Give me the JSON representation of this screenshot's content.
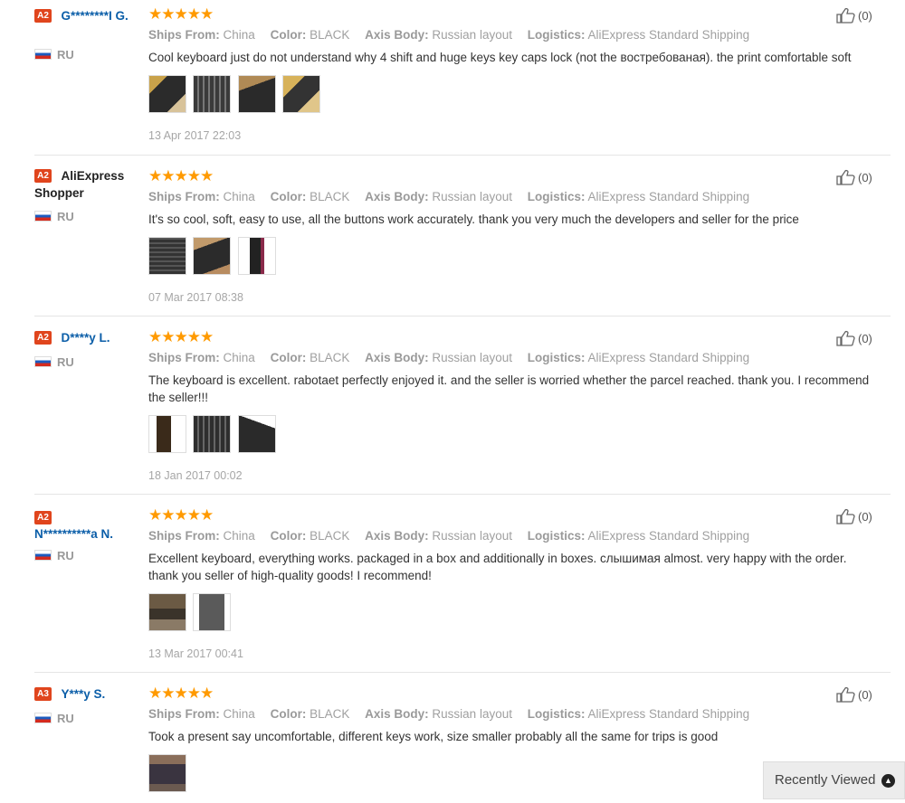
{
  "labels": {
    "ships_from": "Ships From:",
    "color": "Color:",
    "axis_body": "Axis Body:",
    "logistics": "Logistics:"
  },
  "reviews": [
    {
      "badge": "A2",
      "name": "G********I G.",
      "country": "RU",
      "stars": "★★★★★",
      "ships_from": "China",
      "color": "BLACK",
      "axis_body": "Russian layout",
      "logistics": "AliExpress Standard Shipping",
      "text": "Cool keyboard just do not understand why 4 shift and huge keys key caps lock (not the востребованая). the print comfortable soft",
      "date": "13 Apr 2017 22:03",
      "likes": "(0)"
    },
    {
      "badge": "A2",
      "name": "AliExpress Shopper",
      "country": "RU",
      "stars": "★★★★★",
      "ships_from": "China",
      "color": "BLACK",
      "axis_body": "Russian layout",
      "logistics": "AliExpress Standard Shipping",
      "text": "It's so cool, soft, easy to use, all the buttons work accurately. thank you very much the developers and seller for the price",
      "date": "07 Mar 2017 08:38",
      "likes": "(0)"
    },
    {
      "badge": "A2",
      "name": "D****y L.",
      "country": "RU",
      "stars": "★★★★★",
      "ships_from": "China",
      "color": "BLACK",
      "axis_body": "Russian layout",
      "logistics": "AliExpress Standard Shipping",
      "text": "The keyboard is excellent. rabotaet perfectly enjoyed it. and the seller is worried whether the parcel reached. thank you. I recommend the seller!!!",
      "date": "18 Jan 2017 00:02",
      "likes": "(0)"
    },
    {
      "badge": "A2",
      "name": "N**********a N.",
      "country": "RU",
      "stars": "★★★★★",
      "ships_from": "China",
      "color": "BLACK",
      "axis_body": "Russian layout",
      "logistics": "AliExpress Standard Shipping",
      "text": "Excellent keyboard, everything works. packaged in a box and additionally in boxes. слышимая almost. very happy with the order. thank you seller of high-quality goods! I recommend!",
      "date": "13 Mar 2017 00:41",
      "likes": "(0)"
    },
    {
      "badge": "A3",
      "name": "Y***y S.",
      "country": "RU",
      "stars": "★★★★★",
      "ships_from": "China",
      "color": "BLACK",
      "axis_body": "Russian layout",
      "logistics": "AliExpress Standard Shipping",
      "text": "Took a present say uncomfortable, different keys work, size smaller probably all the same for trips is good",
      "likes": "(0)"
    }
  ],
  "recently_viewed": {
    "label": "Recently Viewed",
    "icon": "chevron-up-icon"
  }
}
